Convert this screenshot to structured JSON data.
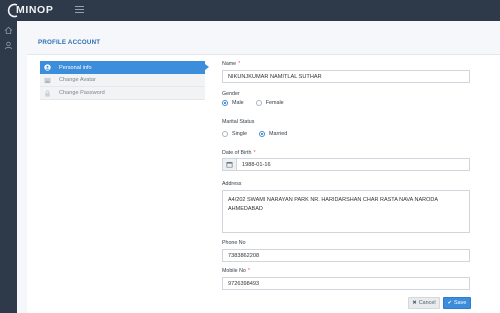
{
  "app": {
    "logo_text": "MINOP"
  },
  "page": {
    "title": "PROFILE ACCOUNT"
  },
  "menu": {
    "items": [
      {
        "label": "Personal info",
        "icon": "user-icon",
        "active": true
      },
      {
        "label": "Change Avatar",
        "icon": "image-icon",
        "active": false
      },
      {
        "label": "Change Password",
        "icon": "lock-icon",
        "active": false
      }
    ]
  },
  "form": {
    "name_label": "Name",
    "name_value": "NIKUNJKUMAR NAMITLAL SUTHAR",
    "gender_label": "Gender",
    "gender_options": [
      "Male",
      "Female"
    ],
    "gender_selected": "Male",
    "marital_label": "Marital Status",
    "marital_options": [
      "Single",
      "Married"
    ],
    "marital_selected": "Married",
    "dob_label": "Date of Birth",
    "dob_value": "1988-01-16",
    "address_label": "Address",
    "address_value": "A4/202 SWAMI NARAYAN PARK NR. HARIDARSHAN CHAR RASTA NAVA NARODA AHMEDABAD",
    "phone_label": "Phone No",
    "phone_value": "7383862208",
    "mobile_label": "Mobile No",
    "mobile_value": "9726398493",
    "required_mark": "*"
  },
  "actions": {
    "cancel_label": "Cancel",
    "save_label": "Save"
  },
  "colors": {
    "topbar": "#2e3a4a",
    "accent": "#3c8ddc",
    "title": "#2f6fb5",
    "required": "#d9534f"
  }
}
